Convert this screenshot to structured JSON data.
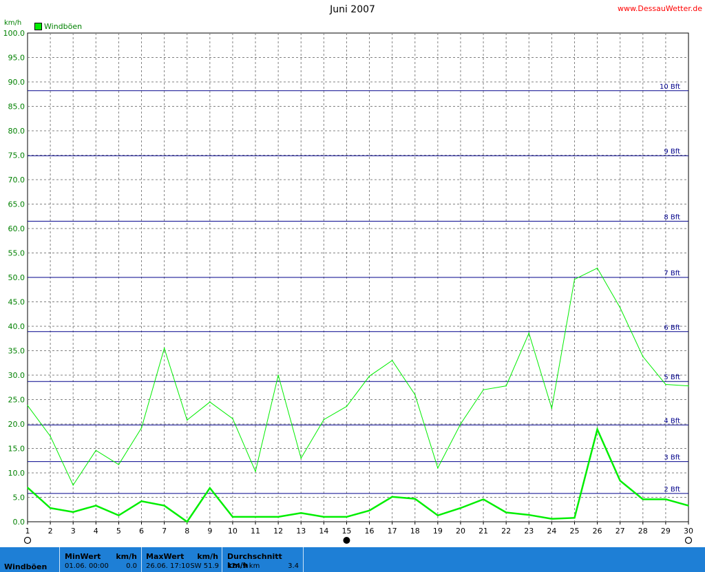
{
  "header": {
    "title": "Juni 2007",
    "site": "www.DessauWetter.de",
    "unit": "km/h"
  },
  "chart_data": {
    "type": "line",
    "title": "Juni 2007",
    "ylabel": "km/h",
    "ylim": [
      0,
      100
    ],
    "xlim": [
      1,
      30
    ],
    "grid": true,
    "legend": "top-left",
    "legend_label": "Windböen",
    "x": [
      1,
      2,
      3,
      4,
      5,
      6,
      7,
      8,
      9,
      10,
      11,
      12,
      13,
      14,
      15,
      16,
      17,
      18,
      19,
      20,
      21,
      22,
      23,
      24,
      25,
      26,
      27,
      28,
      29,
      30
    ],
    "y_ticks": [
      "0.0",
      "5.0",
      "10.0",
      "15.0",
      "20.0",
      "25.0",
      "30.0",
      "35.0",
      "40.0",
      "45.0",
      "50.0",
      "55.0",
      "60.0",
      "65.0",
      "70.0",
      "75.0",
      "80.0",
      "85.0",
      "90.0",
      "95.0",
      "100.0"
    ],
    "x_ticks": [
      "1",
      "2",
      "3",
      "4",
      "5",
      "6",
      "7",
      "8",
      "9",
      "10",
      "11",
      "12",
      "13",
      "14",
      "15",
      "16",
      "17",
      "18",
      "19",
      "20",
      "21",
      "22",
      "23",
      "24",
      "25",
      "26",
      "27",
      "28",
      "29",
      "30"
    ],
    "series": [
      {
        "name": "Windböen",
        "color": "#00ee00",
        "values": [
          23.8,
          17.5,
          7.5,
          14.6,
          11.7,
          19.2,
          35.5,
          20.8,
          24.5,
          21.1,
          10.3,
          30.0,
          13.0,
          20.9,
          23.6,
          29.8,
          33.0,
          26.0,
          11.0,
          20.0,
          27.0,
          27.8,
          38.6,
          23.2,
          49.6,
          51.9,
          43.8,
          33.8,
          28.1,
          27.8
        ]
      },
      {
        "name": "",
        "color": "#00ee00",
        "values": [
          7.0,
          2.8,
          2.0,
          3.3,
          1.3,
          4.2,
          3.3,
          0.0,
          6.9,
          1.0,
          1.0,
          1.0,
          1.8,
          1.0,
          1.0,
          2.3,
          5.1,
          4.7,
          1.3,
          2.8,
          4.6,
          1.9,
          1.4,
          0.6,
          0.8,
          18.9,
          8.4,
          4.6,
          4.6,
          3.3
        ]
      }
    ],
    "reference_lines": [
      {
        "label": "2 Bft",
        "value": 5.8
      },
      {
        "label": "3 Bft",
        "value": 12.3
      },
      {
        "label": "4 Bft",
        "value": 19.8
      },
      {
        "label": "5 Bft",
        "value": 28.7
      },
      {
        "label": "6 Bft",
        "value": 38.9
      },
      {
        "label": "7 Bft",
        "value": 50.0
      },
      {
        "label": "8 Bft",
        "value": 61.5
      },
      {
        "label": "9 Bft",
        "value": 74.9
      },
      {
        "label": "10 Bft",
        "value": 88.2
      }
    ],
    "reference_color": "#00008b",
    "moon_phases": [
      {
        "day": 1,
        "phase": "full-moon"
      },
      {
        "day": 15,
        "phase": "new-moon"
      },
      {
        "day": 30,
        "phase": "full-moon"
      }
    ]
  },
  "stats": {
    "row_label": "Windböen",
    "min": {
      "header": "MinWert",
      "unit": "km/h",
      "date": "01.06.  00:00",
      "value": "0.0"
    },
    "max": {
      "header": "MaxWert",
      "unit": "km/h",
      "date": "26.06.  17:10",
      "dir_value": "SW 51.9"
    },
    "avg": {
      "header": "Durchschnitt km/h",
      "distance": "124.9 km",
      "value": "3.4"
    }
  }
}
